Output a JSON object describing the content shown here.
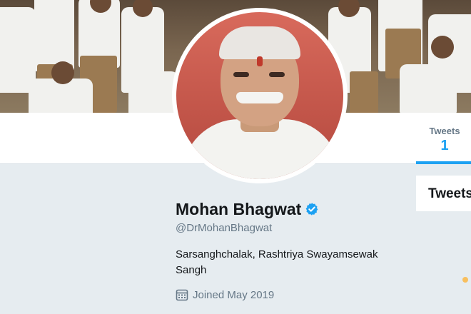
{
  "profile": {
    "name": "Mohan Bhagwat",
    "handle": "@DrMohanBhagwat",
    "bio": "Sarsanghchalak, Rashtriya Swayamsewak Sangh",
    "joined": "Joined May 2019",
    "verified": true
  },
  "nav": {
    "tweets_label": "Tweets",
    "tweets_count": "1"
  },
  "timeline": {
    "header": "Tweets"
  },
  "icons": {
    "verified": "verified-badge-icon",
    "calendar": "calendar-icon"
  },
  "colors": {
    "accent": "#1da1f2",
    "background": "#e6ecf0",
    "secondary_text": "#657786"
  }
}
